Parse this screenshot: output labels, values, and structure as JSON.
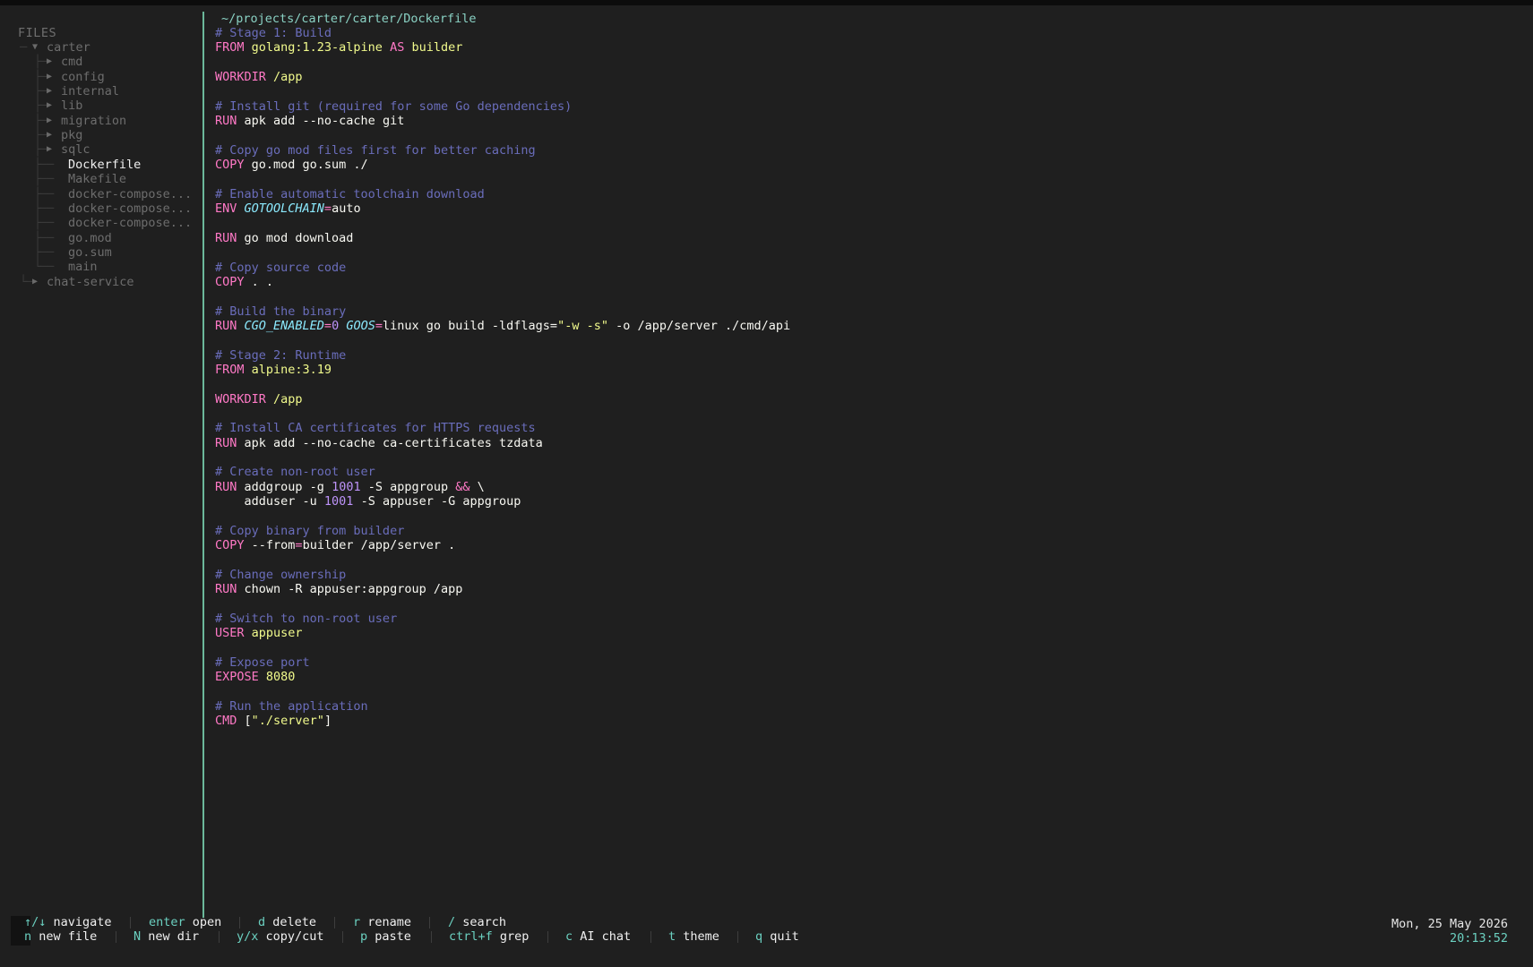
{
  "sidebar": {
    "header": "FILES",
    "root": "carter",
    "folders": [
      "cmd",
      "config",
      "internal",
      "lib",
      "migration",
      "pkg",
      "sqlc"
    ],
    "files": [
      "Dockerfile",
      "Makefile",
      "docker-compose...",
      "docker-compose...",
      "docker-compose...",
      "go.mod",
      "go.sum",
      "main"
    ],
    "sibling": "chat-service",
    "active_file": "Dockerfile"
  },
  "editor": {
    "path": "~/projects/carter/carter/Dockerfile",
    "lines": [
      [
        [
          "com",
          "# Stage 1: Build"
        ]
      ],
      [
        [
          "kw",
          "FROM "
        ],
        [
          "img",
          "golang:1.23-alpine "
        ],
        [
          "kw",
          "AS "
        ],
        [
          "img",
          "builder"
        ]
      ],
      [],
      [
        [
          "kw",
          "WORKDIR "
        ],
        [
          "img",
          "/app"
        ]
      ],
      [],
      [
        [
          "com",
          "# Install git (required for some Go dependencies)"
        ]
      ],
      [
        [
          "kw",
          "RUN "
        ],
        [
          "ident",
          "apk add --no-cache git"
        ]
      ],
      [],
      [
        [
          "com",
          "# Copy go mod files first for better caching"
        ]
      ],
      [
        [
          "kw",
          "COPY "
        ],
        [
          "ident",
          "go.mod go.sum ./"
        ]
      ],
      [],
      [
        [
          "com",
          "# Enable automatic toolchain download"
        ]
      ],
      [
        [
          "kw",
          "ENV "
        ],
        [
          "var",
          "GOTOOLCHAIN"
        ],
        [
          "op",
          "="
        ],
        [
          "ident",
          "auto"
        ]
      ],
      [],
      [
        [
          "kw",
          "RUN "
        ],
        [
          "ident",
          "go mod download"
        ]
      ],
      [],
      [
        [
          "com",
          "# Copy source code"
        ]
      ],
      [
        [
          "kw",
          "COPY "
        ],
        [
          "ident",
          ". ."
        ]
      ],
      [],
      [
        [
          "com",
          "# Build the binary"
        ]
      ],
      [
        [
          "kw",
          "RUN "
        ],
        [
          "var",
          "CGO_ENABLED"
        ],
        [
          "op",
          "="
        ],
        [
          "num",
          "0"
        ],
        [
          "ident",
          " "
        ],
        [
          "var",
          "GOOS"
        ],
        [
          "op",
          "="
        ],
        [
          "ident",
          "linux go build -ldflags="
        ],
        [
          "str",
          "\"-w -s\""
        ],
        [
          "ident",
          " -o /app/server ./cmd/api"
        ]
      ],
      [],
      [
        [
          "com",
          "# Stage 2: Runtime"
        ]
      ],
      [
        [
          "kw",
          "FROM "
        ],
        [
          "img",
          "alpine:3.19"
        ]
      ],
      [],
      [
        [
          "kw",
          "WORKDIR "
        ],
        [
          "img",
          "/app"
        ]
      ],
      [],
      [
        [
          "com",
          "# Install CA certificates for HTTPS requests"
        ]
      ],
      [
        [
          "kw",
          "RUN "
        ],
        [
          "ident",
          "apk add --no-cache ca-certificates tzdata"
        ]
      ],
      [],
      [
        [
          "com",
          "# Create non-root user"
        ]
      ],
      [
        [
          "kw",
          "RUN "
        ],
        [
          "ident",
          "addgroup -g "
        ],
        [
          "num",
          "1001"
        ],
        [
          "ident",
          " -S appgroup "
        ],
        [
          "op",
          "&&"
        ],
        [
          "ident",
          " \\"
        ]
      ],
      [
        [
          "ident",
          "    adduser -u "
        ],
        [
          "num",
          "1001"
        ],
        [
          "ident",
          " -S appuser -G appgroup"
        ]
      ],
      [],
      [
        [
          "com",
          "# Copy binary from builder"
        ]
      ],
      [
        [
          "kw",
          "COPY "
        ],
        [
          "ident",
          "--from"
        ],
        [
          "op",
          "="
        ],
        [
          "ident",
          "builder /app/server ."
        ]
      ],
      [],
      [
        [
          "com",
          "# Change ownership"
        ]
      ],
      [
        [
          "kw",
          "RUN "
        ],
        [
          "ident",
          "chown -R appuser:appgroup /app"
        ]
      ],
      [],
      [
        [
          "com",
          "# Switch to non-root user"
        ]
      ],
      [
        [
          "kw",
          "USER "
        ],
        [
          "img",
          "appuser"
        ]
      ],
      [],
      [
        [
          "com",
          "# Expose port"
        ]
      ],
      [
        [
          "kw",
          "EXPOSE "
        ],
        [
          "img",
          "8080"
        ]
      ],
      [],
      [
        [
          "com",
          "# Run the application"
        ]
      ],
      [
        [
          "kw",
          "CMD "
        ],
        [
          "ident",
          "["
        ],
        [
          "str",
          "\"./server\""
        ],
        [
          "ident",
          "]"
        ]
      ]
    ]
  },
  "statusbar": {
    "row1": [
      {
        "key": "↑/↓",
        "desc": "navigate"
      },
      {
        "key": "enter",
        "desc": "open"
      },
      {
        "key": "d",
        "desc": "delete"
      },
      {
        "key": "r",
        "desc": "rename"
      },
      {
        "key": "/",
        "desc": "search"
      }
    ],
    "row2": [
      {
        "key": "n",
        "desc": "new file"
      },
      {
        "key": "N",
        "desc": "new dir"
      },
      {
        "key": "y/x",
        "desc": "copy/cut"
      },
      {
        "key": "p",
        "desc": "paste"
      },
      {
        "key": "ctrl+f",
        "desc": "grep"
      },
      {
        "key": "c",
        "desc": "AI chat"
      },
      {
        "key": "t",
        "desc": "theme"
      },
      {
        "key": "q",
        "desc": "quit"
      }
    ],
    "date": "Mon, 25 May 2026",
    "time": "20:13:52"
  },
  "colors": {
    "background": "#1f1f1f",
    "accent": "#6bd0c0",
    "divider": "#6bb89a",
    "keyword": "#ff79c6",
    "comment": "#6a6dbb"
  }
}
